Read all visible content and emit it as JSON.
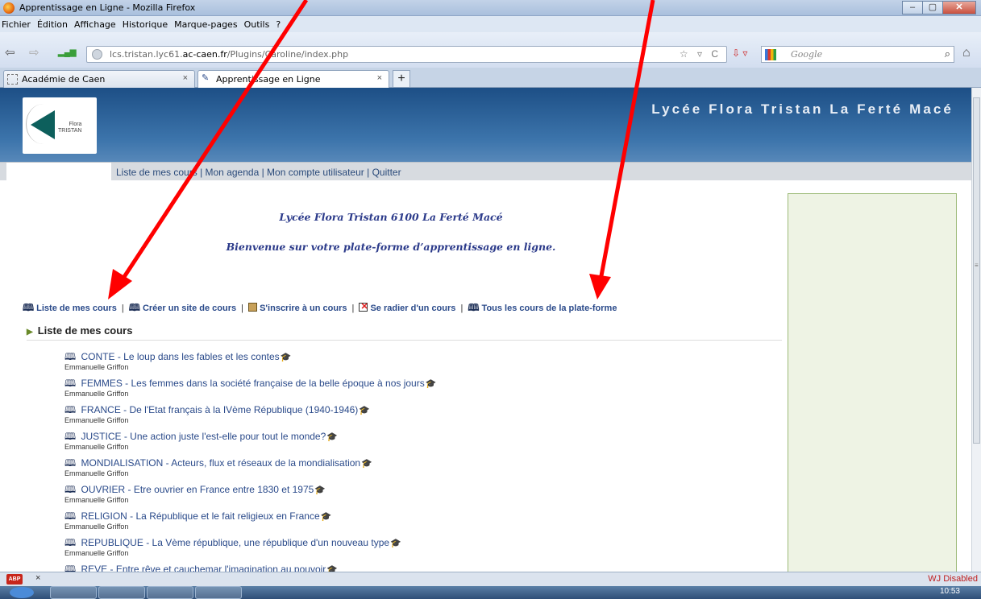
{
  "window": {
    "title": "Apprentissage en Ligne - Mozilla Firefox",
    "min": "‒",
    "max": "▢",
    "close": "✕"
  },
  "menu": [
    "Fichier",
    "Édition",
    "Affichage",
    "Historique",
    "Marque-pages",
    "Outils",
    "?"
  ],
  "nav": {
    "back": "⇦",
    "forward": "⇨",
    "url_prefix": "lcs.tristan.lyc61.",
    "url_domain": "ac-caen.fr",
    "url_path": "/Plugins/Caroline/index.php",
    "url_right": "☆ ▿ C",
    "search_engine": "Google",
    "search_icon": "⌕",
    "home_icon": "⌂"
  },
  "tabs": [
    {
      "label": "Académie de Caen",
      "close": "×"
    },
    {
      "label": "Apprentissage en Ligne",
      "close": "×"
    }
  ],
  "new_tab": "+",
  "page": {
    "logo_text": "Flora\nTRISTAN",
    "site_title": "Lycée Flora Tristan La Ferté Macé",
    "userbar_links": [
      "Liste de mes cours",
      "Mon agenda",
      "Mon compte utilisateur",
      "Quitter"
    ],
    "welcome_line1": "Lycée Flora Tristan 6100 La Ferté Macé",
    "welcome_line2": "Bienvenue sur votre plate-forme d’apprentissage en ligne.",
    "actions": [
      {
        "label": "Liste de mes cours",
        "icon": "book-icon"
      },
      {
        "label": "Créer un site de cours",
        "icon": "book-icon"
      },
      {
        "label": "S'inscrire à un cours",
        "icon": "certificate-icon"
      },
      {
        "label": "Se radier d'un cours",
        "icon": "remove-icon"
      },
      {
        "label": "Tous les cours de la plate-forme",
        "icon": "book-icon"
      }
    ],
    "section_heading": "Liste de mes cours",
    "courses": [
      {
        "title": "CONTE - Le loup dans les fables et les contes",
        "teacher": "Emmanuelle Griffon"
      },
      {
        "title": "FEMMES - Les femmes dans la société française de la belle époque à nos jours",
        "teacher": "Emmanuelle Griffon"
      },
      {
        "title": "FRANCE - De l'Etat français à la IVème République (1940-1946)",
        "teacher": "Emmanuelle Griffon"
      },
      {
        "title": "JUSTICE - Une action juste l'est-elle pour tout le monde?",
        "teacher": "Emmanuelle Griffon"
      },
      {
        "title": "MONDIALISATION - Acteurs, flux et réseaux de la mondialisation",
        "teacher": "Emmanuelle Griffon"
      },
      {
        "title": "OUVRIER - Etre ouvrier en France entre 1830 et 1975",
        "teacher": "Emmanuelle Griffon"
      },
      {
        "title": "RELIGION - La République et le fait religieux en France",
        "teacher": "Emmanuelle Griffon"
      },
      {
        "title": "REPUBLIQUE - La Vème république, une république d'un nouveau type",
        "teacher": "Emmanuelle Griffon"
      },
      {
        "title": "REVE - Entre rêve et cauchemar l'imagination au pouvoir",
        "teacher": ""
      }
    ]
  },
  "statusbar": {
    "abp": "ABP",
    "close": "×",
    "wj": "WJ Disabled"
  },
  "taskbar": {
    "clock": "10:53"
  },
  "colors": {
    "link": "#2a4a8a",
    "banner": "#2f5f95",
    "annotation": "#ff0000",
    "sidebox": "#eef3e4"
  }
}
